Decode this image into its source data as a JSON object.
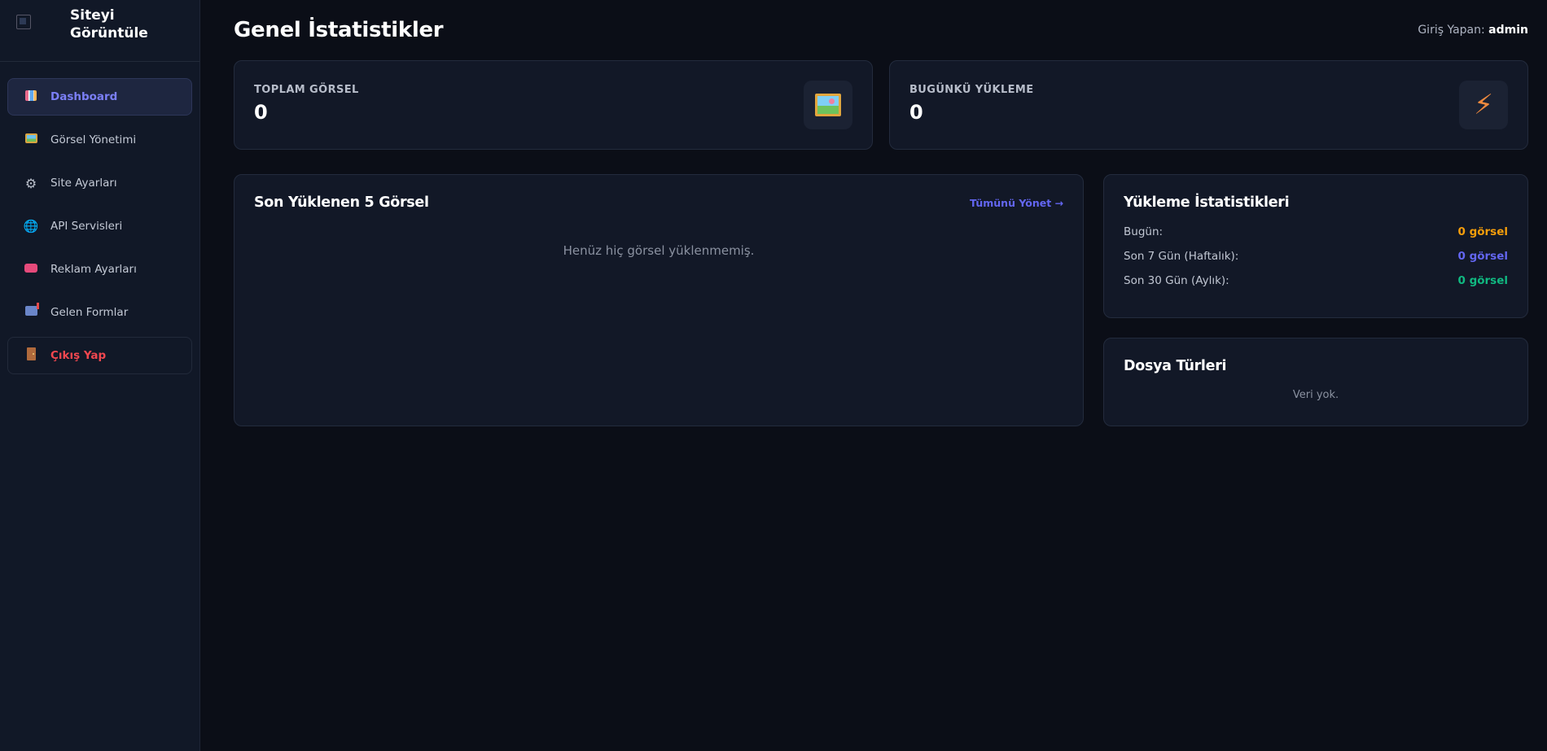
{
  "sidebar": {
    "brand": "Siteyi Görüntüle",
    "items": [
      {
        "label": "Dashboard",
        "icon": "bar-chart-icon"
      },
      {
        "label": "Görsel Yönetimi",
        "icon": "image-icon"
      },
      {
        "label": "Site Ayarları",
        "icon": "gear-icon"
      },
      {
        "label": "API Servisleri",
        "icon": "globe-icon"
      },
      {
        "label": "Reklam Ayarları",
        "icon": "ad-icon"
      },
      {
        "label": "Gelen Formlar",
        "icon": "mailbox-icon"
      },
      {
        "label": "Çıkış Yap",
        "icon": "door-icon"
      }
    ]
  },
  "header": {
    "title": "Genel İstatistikler",
    "user_prefix": "Giriş Yapan:",
    "user_name": "admin"
  },
  "stats": [
    {
      "label": "TOPLAM GÖRSEL",
      "value": "0",
      "icon": "image-icon"
    },
    {
      "label": "BUGÜNKÜ YÜKLEME",
      "value": "0",
      "icon": "lightning-icon"
    }
  ],
  "recent": {
    "title": "Son Yüklenen 5 Görsel",
    "link": "Tümünü Yönet →",
    "empty": "Henüz hiç görsel yüklenmemiş."
  },
  "upload_stats": {
    "title": "Yükleme İstatistikleri",
    "rows": [
      {
        "label": "Bugün:",
        "value": "0 görsel",
        "color": "#f59e0b"
      },
      {
        "label": "Son 7 Gün (Haftalık):",
        "value": "0 görsel",
        "color": "#6366f1"
      },
      {
        "label": "Son 30 Gün (Aylık):",
        "value": "0 görsel",
        "color": "#10b981"
      }
    ]
  },
  "file_types": {
    "title": "Dosya Türleri",
    "empty": "Veri yok."
  },
  "colors": {
    "accent": "#6366f1",
    "danger": "#f2474f",
    "background": "#0b0e17",
    "panel": "#121827"
  }
}
